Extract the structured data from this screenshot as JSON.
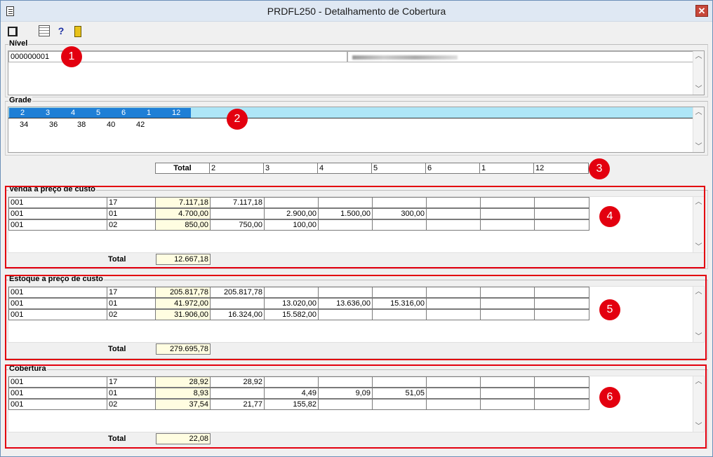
{
  "window": {
    "title": "PRDFL250 - Detalhamento de Cobertura",
    "close_label": "✕"
  },
  "toolbar": {
    "help_label": "?"
  },
  "nivel": {
    "label": "Nível",
    "code": "000000001"
  },
  "grade": {
    "label": "Grade",
    "row1": [
      "2",
      "3",
      "4",
      "5",
      "6",
      "1",
      "12"
    ],
    "row2": [
      "34",
      "36",
      "38",
      "40",
      "42"
    ]
  },
  "header": {
    "total_label": "Total",
    "cols": [
      "2",
      "3",
      "4",
      "5",
      "6",
      "1",
      "12"
    ]
  },
  "venda": {
    "label": "Venda a preço de custo",
    "rows": [
      [
        "001",
        "17",
        "7.117,18",
        "7.117,18",
        "",
        "",
        "",
        "",
        "",
        ""
      ],
      [
        "001",
        "01",
        "4.700,00",
        "",
        "2.900,00",
        "1.500,00",
        "300,00",
        "",
        "",
        ""
      ],
      [
        "001",
        "02",
        "850,00",
        "750,00",
        "100,00",
        "",
        "",
        "",
        "",
        ""
      ]
    ],
    "total_label": "Total",
    "total": "12.667,18"
  },
  "estoque": {
    "label": "Estoque a preço de custo",
    "rows": [
      [
        "001",
        "17",
        "205.817,78",
        "205.817,78",
        "",
        "",
        "",
        "",
        "",
        ""
      ],
      [
        "001",
        "01",
        "41.972,00",
        "",
        "13.020,00",
        "13.636,00",
        "15.316,00",
        "",
        "",
        ""
      ],
      [
        "001",
        "02",
        "31.906,00",
        "16.324,00",
        "15.582,00",
        "",
        "",
        "",
        "",
        ""
      ]
    ],
    "total_label": "Total",
    "total": "279.695,78"
  },
  "cobertura": {
    "label": "Cobertura",
    "rows": [
      [
        "001",
        "17",
        "28,92",
        "28,92",
        "",
        "",
        "",
        "",
        "",
        ""
      ],
      [
        "001",
        "01",
        "8,93",
        "",
        "4,49",
        "9,09",
        "51,05",
        "",
        "",
        ""
      ],
      [
        "001",
        "02",
        "37,54",
        "21,77",
        "155,82",
        "",
        "",
        "",
        "",
        ""
      ]
    ],
    "total_label": "Total",
    "total": "22,08"
  },
  "badges": [
    "1",
    "2",
    "3",
    "4",
    "5",
    "6"
  ],
  "colors": {
    "accent_red": "#e3000f",
    "grade_selected": "#1e7fd6",
    "grade_row_bg": "#aee6f7",
    "highlight_cell": "#fffde1"
  }
}
